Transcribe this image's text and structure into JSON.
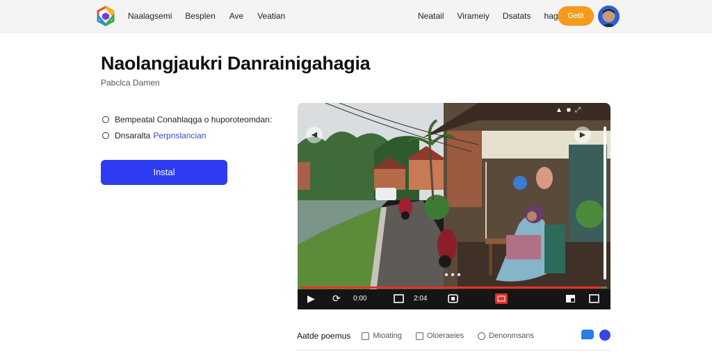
{
  "nav": {
    "left": [
      "Naalagsemi",
      "Besplen",
      "Ave",
      "Veatian"
    ],
    "right": [
      "Neatail",
      "Virameiy",
      "Dsatats",
      "hag"
    ],
    "get_button": "Getit"
  },
  "hero": {
    "title": "Naolangjaukri Danrainigahagia",
    "subtitle": "Pabclca Damen",
    "options": [
      {
        "text": "Bempeatal Conahlaqga o huporoteomdan:"
      },
      {
        "text": "Dnsaralta",
        "link": "Perpnslancian"
      }
    ],
    "install_button": "Instal"
  },
  "player": {
    "time_left": "0:00",
    "time_right": "2:04",
    "progress_percent": 98,
    "carousel_dots": 3
  },
  "tabs": {
    "first": "Aatde poemus",
    "items": [
      "Mioating",
      "Oloeraeies",
      "Denonmsans"
    ]
  },
  "colors": {
    "accent": "#2d3cf0",
    "get_button": "#f59a1b",
    "progress": "#e8302a",
    "link": "#3a47c9"
  },
  "icons": [
    "logo-hexagon-icon",
    "avatar-icon",
    "radio-icon",
    "play-icon",
    "replay-icon",
    "caption-icon",
    "settings-icon",
    "live-icon",
    "pip-icon",
    "fullscreen-icon",
    "chat-icon",
    "messenger-icon"
  ]
}
